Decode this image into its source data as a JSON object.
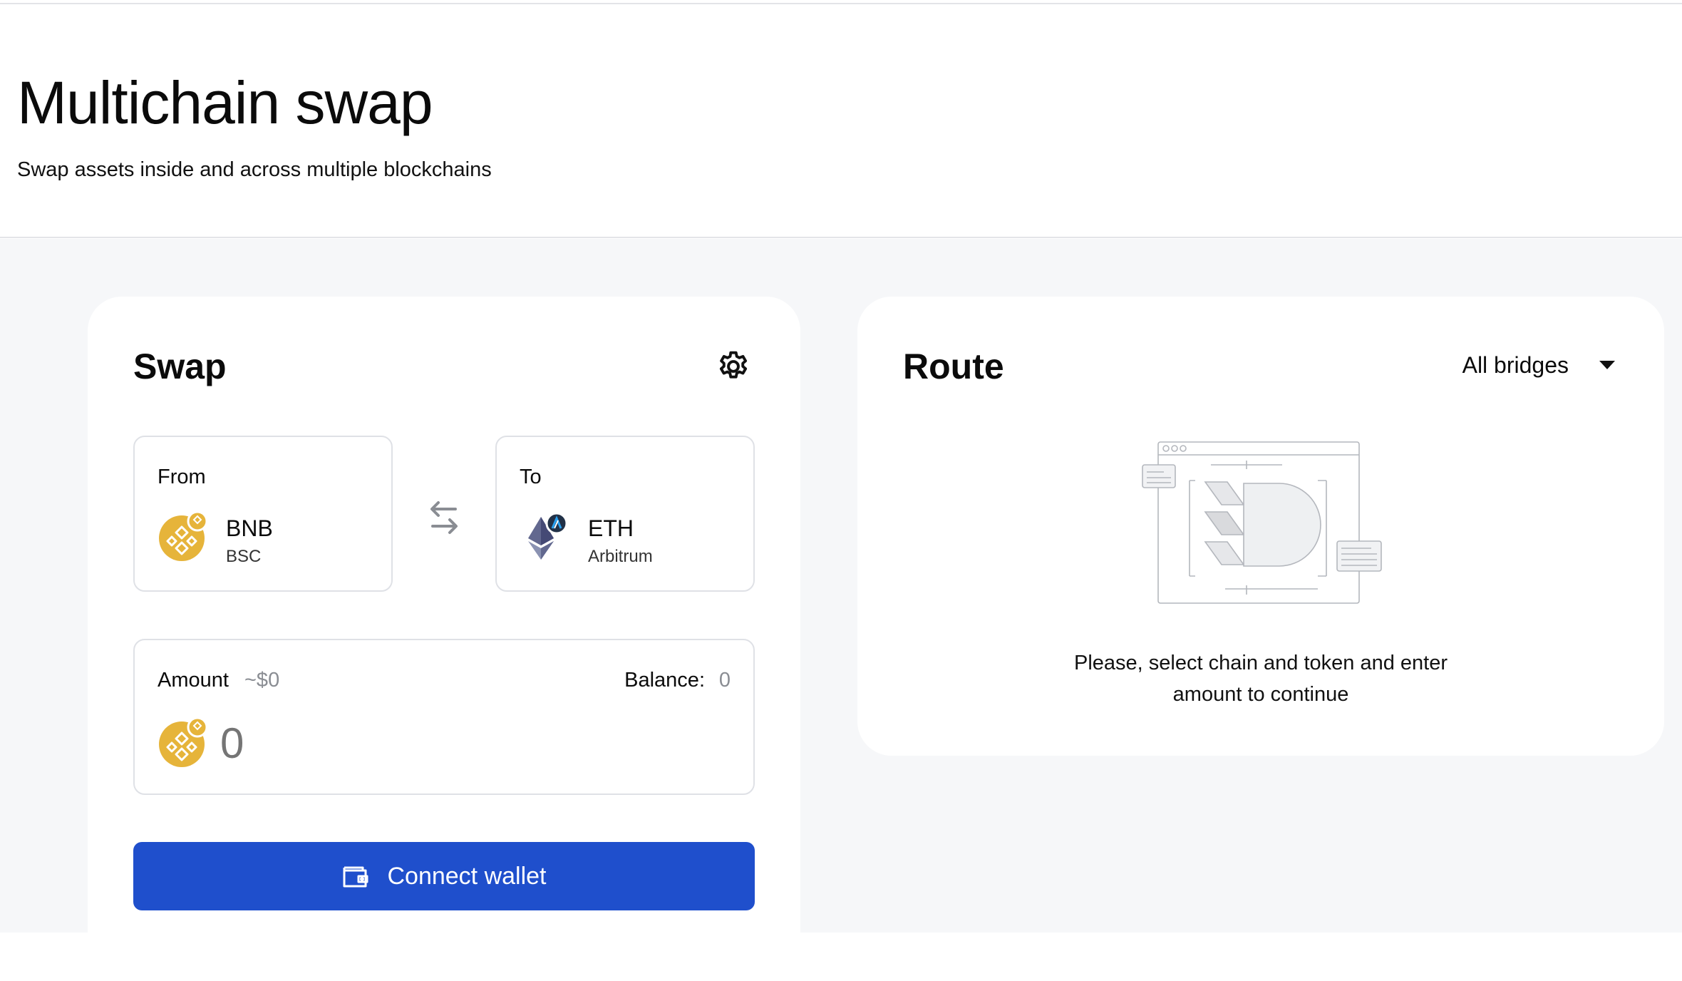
{
  "page": {
    "title": "Multichain swap",
    "subtitle": "Swap assets inside and across multiple blockchains"
  },
  "swap": {
    "title": "Swap",
    "settings_icon": "gear-icon",
    "from": {
      "label": "From",
      "symbol": "BNB",
      "chain": "BSC",
      "icon": "bnb-token-icon"
    },
    "to": {
      "label": "To",
      "symbol": "ETH",
      "chain": "Arbitrum",
      "icon": "eth-arbitrum-token-icon"
    },
    "switch_icon": "swap-arrows-icon",
    "amount": {
      "label": "Amount",
      "usd": "~$0",
      "balance_label": "Balance:",
      "balance_value": "0",
      "placeholder": "0"
    },
    "connect_label": "Connect wallet",
    "connect_icon": "wallet-icon"
  },
  "route": {
    "title": "Route",
    "bridge_filter": "All bridges",
    "message_line1": "Please, select chain and token and enter",
    "message_line2": "amount to continue"
  },
  "colors": {
    "primary_button": "#1f4fcc",
    "bnb_gold": "#e6b43a",
    "page_bg": "#f6f7f9"
  }
}
